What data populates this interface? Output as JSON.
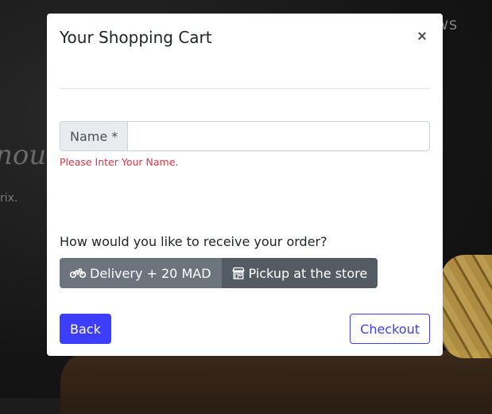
{
  "background": {
    "nav_text": "WS",
    "hero_text": "nou",
    "small_text": "rix."
  },
  "modal": {
    "title": "Your Shopping Cart",
    "close_label": "×",
    "name_label": "Name *",
    "name_value": "",
    "name_placeholder": "",
    "name_error": "Please Inter Your Name.",
    "question": "How would you like to receive your order?",
    "options": [
      {
        "label": "Delivery + 20 MAD",
        "icon": "motorcycle-icon"
      },
      {
        "label": "Pickup at the store",
        "icon": "store-icon"
      }
    ],
    "back_label": "Back",
    "checkout_label": "Checkout"
  },
  "colors": {
    "primary": "#3d3dff",
    "secondary": "#6c757d",
    "secondary_active": "#545b62",
    "error": "#dc3545"
  }
}
